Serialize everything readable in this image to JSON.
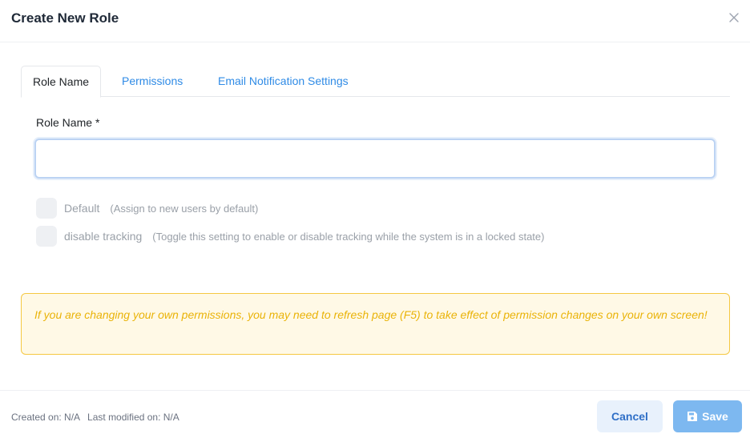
{
  "modal": {
    "title": "Create New Role"
  },
  "tabs": [
    {
      "label": "Role Name"
    },
    {
      "label": "Permissions"
    },
    {
      "label": "Email Notification Settings"
    }
  ],
  "form": {
    "role_name_label": "Role Name",
    "required_mark": "*",
    "role_name_value": "",
    "options": [
      {
        "label": "Default",
        "hint": "(Assign to new users by default)"
      },
      {
        "label": "disable tracking",
        "hint": "(Toggle this setting to enable or disable tracking while the system is in a locked state)"
      }
    ]
  },
  "alert": {
    "text": "If you are changing your own permissions, you may need to refresh page (F5) to take effect of permission changes on your own screen!"
  },
  "footer": {
    "created": "Created on: N/A",
    "modified": "Last modified on: N/A",
    "cancel_label": "Cancel",
    "save_label": "Save"
  },
  "colors": {
    "accent": "#2f8be6",
    "save_button": "#7db8f0",
    "alert_border": "#f5c842",
    "alert_text": "#eab308"
  },
  "icons": {
    "close": "close-icon",
    "save": "floppy-disk-icon"
  }
}
